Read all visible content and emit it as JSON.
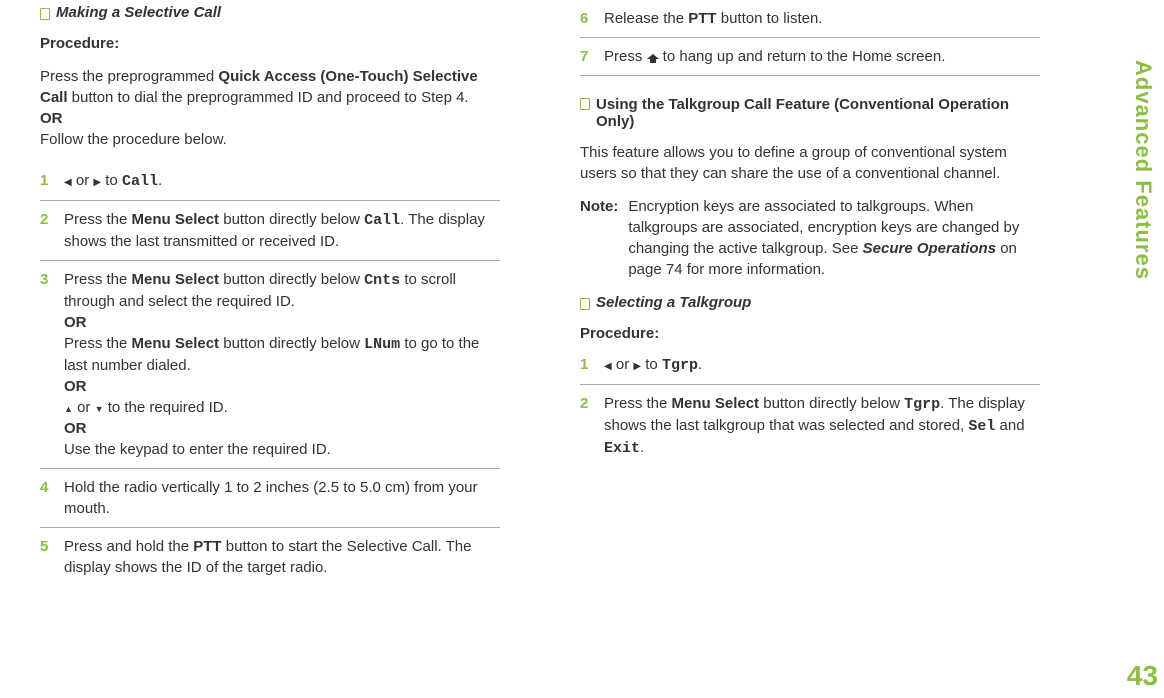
{
  "sidebar_label": "Advanced Features",
  "page_number": "43",
  "left": {
    "section_title": "Making a Selective Call",
    "procedure_label": "Procedure:",
    "intro_part1": "Press the preprogrammed ",
    "intro_bold": "Quick Access (One-Touch) Selective Call",
    "intro_part2": " button to dial the preprogrammed ID and proceed to Step 4.",
    "or": "OR",
    "intro_part3": "Follow the procedure below.",
    "steps": {
      "s1": {
        "num": "1",
        "to": " to ",
        "call": "Call",
        "period": ".",
        "or_word": " or "
      },
      "s2": {
        "num": "2",
        "a": "Press the ",
        "b": "Menu Select",
        "c": " button directly below ",
        "d": "Call",
        "e": ". The display shows the last transmitted or received ID."
      },
      "s3": {
        "num": "3",
        "a": "Press the ",
        "b": "Menu Select",
        "c": " button directly below ",
        "d": "Cnts",
        "e": " to scroll through and select the required ID.",
        "or": "OR",
        "f": "Press the ",
        "g": "Menu Select",
        "h": " button directly below ",
        "i": "LNum",
        "j": " to go to the last number dialed.",
        "or2": "OR",
        "k_or": " or ",
        "l": " to the required ID.",
        "or3": "OR",
        "m": "Use the keypad to enter the required ID."
      },
      "s4": {
        "num": "4",
        "text": "Hold the radio vertically 1 to 2 inches (2.5 to 5.0 cm) from your mouth."
      },
      "s5": {
        "num": "5",
        "a": "Press and hold the ",
        "b": "PTT",
        "c": " button to start the Selective Call. The display shows the ID of the target radio."
      }
    }
  },
  "right": {
    "steps_top": {
      "s6": {
        "num": "6",
        "a": "Release the ",
        "b": "PTT",
        "c": " button to listen."
      },
      "s7": {
        "num": "7",
        "a": "Press ",
        "b": " to hang up and return to the Home screen."
      }
    },
    "section2_title": "Using the Talkgroup Call Feature (Conventional Operation Only)",
    "section2_body": "This feature allows you to define a group of conventional system users so that they can share the use of a conventional channel.",
    "note_label": "Note:",
    "note_a": "Encryption keys are associated to talkgroups. When talkgroups are associated, encryption keys are changed by changing the active talkgroup. See ",
    "note_b": "Secure Operations",
    "note_c": " on page 74 for more information.",
    "section3_title": "Selecting a Talkgroup",
    "procedure_label": "Procedure:",
    "steps2": {
      "s1": {
        "num": "1",
        "or_word": " or ",
        "to": " to ",
        "tg": "Tgrp",
        "period": "."
      },
      "s2": {
        "num": "2",
        "a": "Press the ",
        "b": "Menu Select",
        "c": " button directly below ",
        "d": "Tgrp",
        "e": ". The display shows the last talkgroup that was selected and stored, ",
        "f": "Sel",
        "g": " and ",
        "h": "Exit",
        "i": "."
      }
    }
  }
}
